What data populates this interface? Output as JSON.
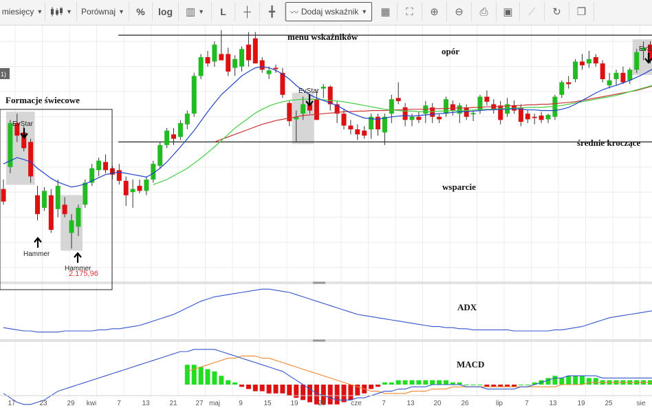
{
  "toolbar": {
    "period": "miesięcy",
    "compare": "Porównaj",
    "percent": "%",
    "log": "log",
    "line": "L",
    "add_indicator": "Dodaj wskaźnik",
    "icons": [
      "candles-icon",
      "bars-icon",
      "crosshair-icon",
      "crosshair2-icon",
      "grid-icon",
      "fullscreen-icon",
      "zoom-in-icon",
      "zoom-out-icon",
      "print-icon",
      "image-icon",
      "chart-icon",
      "refresh-icon",
      "window-icon"
    ]
  },
  "annotations": {
    "menu": "menu wskaźników",
    "resistance": "opór",
    "support": "wsparcie",
    "moving_averages": "średnie kroczące",
    "candle_patterns": "Formacje świecowe",
    "adx": "ADX",
    "macd": "MACD",
    "evstar": "EvStar",
    "hammer": "Hammer",
    "evs_cut": "EvS",
    "price_label": "2.175,96",
    "legend_cut": "1)"
  },
  "colors": {
    "up": "#22bb22",
    "down": "#dd1111",
    "sma_short": "#2244cc",
    "sma_mid": "#44cc44",
    "sma_long": "#cc3333",
    "adx": "#3355cc",
    "macd": "#3355cc",
    "signal": "#ee8833"
  },
  "chart_data": {
    "type": "candlestick",
    "x_ticks": [
      "17",
      "23",
      "29",
      "kwi",
      "7",
      "13",
      "21",
      "27",
      "maj",
      "9",
      "15",
      "19",
      "25",
      "cze",
      "7",
      "13",
      "20",
      "26",
      "lip",
      "7",
      "13",
      "19",
      "25",
      "sie"
    ],
    "price_lines": {
      "resistance": 2470,
      "support": 2300
    },
    "y_range": [
      2080,
      2480
    ],
    "candles": [
      {
        "o": 2225,
        "h": 2240,
        "l": 2200,
        "c": 2205
      },
      {
        "o": 2260,
        "h": 2335,
        "l": 2250,
        "c": 2330
      },
      {
        "o": 2330,
        "h": 2345,
        "l": 2300,
        "c": 2310
      },
      {
        "o": 2315,
        "h": 2325,
        "l": 2285,
        "c": 2290
      },
      {
        "o": 2300,
        "h": 2305,
        "l": 2235,
        "c": 2245
      },
      {
        "o": 2215,
        "h": 2230,
        "l": 2175,
        "c": 2185
      },
      {
        "o": 2195,
        "h": 2228,
        "l": 2190,
        "c": 2222
      },
      {
        "o": 2215,
        "h": 2225,
        "l": 2155,
        "c": 2160
      },
      {
        "o": 2193,
        "h": 2240,
        "l": 2180,
        "c": 2230
      },
      {
        "o": 2200,
        "h": 2212,
        "l": 2180,
        "c": 2185
      },
      {
        "o": 2155,
        "h": 2185,
        "l": 2130,
        "c": 2175
      },
      {
        "o": 2165,
        "h": 2200,
        "l": 2150,
        "c": 2195
      },
      {
        "o": 2200,
        "h": 2240,
        "l": 2195,
        "c": 2235
      },
      {
        "o": 2235,
        "h": 2265,
        "l": 2230,
        "c": 2258
      },
      {
        "o": 2255,
        "h": 2275,
        "l": 2245,
        "c": 2270
      },
      {
        "o": 2268,
        "h": 2280,
        "l": 2250,
        "c": 2255
      },
      {
        "o": 2258,
        "h": 2262,
        "l": 2240,
        "c": 2248
      },
      {
        "o": 2255,
        "h": 2265,
        "l": 2232,
        "c": 2238
      },
      {
        "o": 2238,
        "h": 2245,
        "l": 2198,
        "c": 2215
      },
      {
        "o": 2220,
        "h": 2240,
        "l": 2195,
        "c": 2225
      },
      {
        "o": 2230,
        "h": 2240,
        "l": 2218,
        "c": 2222
      },
      {
        "o": 2222,
        "h": 2245,
        "l": 2215,
        "c": 2240
      },
      {
        "o": 2240,
        "h": 2270,
        "l": 2235,
        "c": 2265
      },
      {
        "o": 2262,
        "h": 2300,
        "l": 2258,
        "c": 2295
      },
      {
        "o": 2295,
        "h": 2322,
        "l": 2290,
        "c": 2318
      },
      {
        "o": 2312,
        "h": 2322,
        "l": 2295,
        "c": 2305
      },
      {
        "o": 2308,
        "h": 2335,
        "l": 2303,
        "c": 2330
      },
      {
        "o": 2328,
        "h": 2350,
        "l": 2320,
        "c": 2345
      },
      {
        "o": 2345,
        "h": 2410,
        "l": 2340,
        "c": 2405
      },
      {
        "o": 2405,
        "h": 2440,
        "l": 2400,
        "c": 2435
      },
      {
        "o": 2435,
        "h": 2445,
        "l": 2420,
        "c": 2425
      },
      {
        "o": 2428,
        "h": 2460,
        "l": 2420,
        "c": 2455
      },
      {
        "o": 2440,
        "h": 2478,
        "l": 2430,
        "c": 2430
      },
      {
        "o": 2440,
        "h": 2450,
        "l": 2405,
        "c": 2412
      },
      {
        "o": 2418,
        "h": 2438,
        "l": 2405,
        "c": 2432
      },
      {
        "o": 2420,
        "h": 2452,
        "l": 2412,
        "c": 2448
      },
      {
        "o": 2455,
        "h": 2475,
        "l": 2420,
        "c": 2430
      },
      {
        "o": 2465,
        "h": 2475,
        "l": 2425,
        "c": 2425
      },
      {
        "o": 2430,
        "h": 2435,
        "l": 2410,
        "c": 2415
      },
      {
        "o": 2408,
        "h": 2420,
        "l": 2400,
        "c": 2414
      },
      {
        "o": 2418,
        "h": 2423,
        "l": 2410,
        "c": 2416
      },
      {
        "o": 2410,
        "h": 2418,
        "l": 2370,
        "c": 2375
      },
      {
        "o": 2362,
        "h": 2365,
        "l": 2325,
        "c": 2333
      },
      {
        "o": 2336,
        "h": 2350,
        "l": 2300,
        "c": 2340
      },
      {
        "o": 2345,
        "h": 2372,
        "l": 2335,
        "c": 2360
      },
      {
        "o": 2360,
        "h": 2375,
        "l": 2345,
        "c": 2350
      },
      {
        "o": 2368,
        "h": 2380,
        "l": 2340,
        "c": 2335
      },
      {
        "o": 2385,
        "h": 2392,
        "l": 2370,
        "c": 2388
      },
      {
        "o": 2388,
        "h": 2390,
        "l": 2350,
        "c": 2360
      },
      {
        "o": 2360,
        "h": 2365,
        "l": 2330,
        "c": 2345
      },
      {
        "o": 2345,
        "h": 2352,
        "l": 2320,
        "c": 2326
      },
      {
        "o": 2326,
        "h": 2335,
        "l": 2312,
        "c": 2320
      },
      {
        "o": 2320,
        "h": 2328,
        "l": 2303,
        "c": 2312
      },
      {
        "o": 2318,
        "h": 2325,
        "l": 2305,
        "c": 2310
      },
      {
        "o": 2320,
        "h": 2345,
        "l": 2305,
        "c": 2340
      },
      {
        "o": 2340,
        "h": 2345,
        "l": 2310,
        "c": 2320
      },
      {
        "o": 2315,
        "h": 2345,
        "l": 2295,
        "c": 2340
      },
      {
        "o": 2345,
        "h": 2375,
        "l": 2330,
        "c": 2368
      },
      {
        "o": 2370,
        "h": 2395,
        "l": 2360,
        "c": 2365
      },
      {
        "o": 2355,
        "h": 2362,
        "l": 2325,
        "c": 2335
      },
      {
        "o": 2335,
        "h": 2345,
        "l": 2325,
        "c": 2340
      },
      {
        "o": 2340,
        "h": 2348,
        "l": 2330,
        "c": 2335
      },
      {
        "o": 2345,
        "h": 2365,
        "l": 2330,
        "c": 2358
      },
      {
        "o": 2355,
        "h": 2362,
        "l": 2330,
        "c": 2340
      },
      {
        "o": 2340,
        "h": 2345,
        "l": 2330,
        "c": 2336
      },
      {
        "o": 2345,
        "h": 2372,
        "l": 2340,
        "c": 2368
      },
      {
        "o": 2360,
        "h": 2366,
        "l": 2342,
        "c": 2350
      },
      {
        "o": 2345,
        "h": 2362,
        "l": 2330,
        "c": 2358
      },
      {
        "o": 2355,
        "h": 2360,
        "l": 2335,
        "c": 2340
      },
      {
        "o": 2344,
        "h": 2350,
        "l": 2333,
        "c": 2346
      },
      {
        "o": 2350,
        "h": 2375,
        "l": 2345,
        "c": 2372
      },
      {
        "o": 2372,
        "h": 2382,
        "l": 2358,
        "c": 2364
      },
      {
        "o": 2360,
        "h": 2368,
        "l": 2345,
        "c": 2352
      },
      {
        "o": 2358,
        "h": 2365,
        "l": 2328,
        "c": 2335
      },
      {
        "o": 2345,
        "h": 2370,
        "l": 2340,
        "c": 2360
      },
      {
        "o": 2358,
        "h": 2366,
        "l": 2345,
        "c": 2350
      },
      {
        "o": 2355,
        "h": 2360,
        "l": 2325,
        "c": 2332
      },
      {
        "o": 2345,
        "h": 2350,
        "l": 2330,
        "c": 2336
      },
      {
        "o": 2340,
        "h": 2345,
        "l": 2328,
        "c": 2338
      },
      {
        "o": 2342,
        "h": 2348,
        "l": 2330,
        "c": 2335
      },
      {
        "o": 2336,
        "h": 2345,
        "l": 2330,
        "c": 2343
      },
      {
        "o": 2340,
        "h": 2375,
        "l": 2335,
        "c": 2372
      },
      {
        "o": 2375,
        "h": 2398,
        "l": 2370,
        "c": 2395
      },
      {
        "o": 2395,
        "h": 2405,
        "l": 2385,
        "c": 2392
      },
      {
        "o": 2400,
        "h": 2432,
        "l": 2395,
        "c": 2428
      },
      {
        "o": 2428,
        "h": 2440,
        "l": 2415,
        "c": 2422
      },
      {
        "o": 2425,
        "h": 2445,
        "l": 2418,
        "c": 2432
      },
      {
        "o": 2435,
        "h": 2440,
        "l": 2420,
        "c": 2425
      },
      {
        "o": 2425,
        "h": 2430,
        "l": 2395,
        "c": 2400
      },
      {
        "o": 2390,
        "h": 2410,
        "l": 2385,
        "c": 2398
      },
      {
        "o": 2400,
        "h": 2415,
        "l": 2390,
        "c": 2410
      },
      {
        "o": 2410,
        "h": 2420,
        "l": 2392,
        "c": 2395
      },
      {
        "o": 2398,
        "h": 2418,
        "l": 2392,
        "c": 2415
      },
      {
        "o": 2415,
        "h": 2448,
        "l": 2410,
        "c": 2443
      },
      {
        "o": 2445,
        "h": 2460,
        "l": 2430,
        "c": 2450
      },
      {
        "o": 2455,
        "h": 2460,
        "l": 2425,
        "c": 2430
      }
    ],
    "sma_short": [
      2265,
      2270,
      2275,
      2272,
      2268,
      2258,
      2250,
      2242,
      2236,
      2232,
      2228,
      2230,
      2233,
      2238,
      2243,
      2248,
      2250,
      2252,
      2250,
      2248,
      2246,
      2244,
      2250,
      2258,
      2268,
      2280,
      2292,
      2305,
      2318,
      2333,
      2348,
      2362,
      2375,
      2385,
      2395,
      2405,
      2412,
      2418,
      2420,
      2418,
      2414,
      2408,
      2400,
      2390,
      2382,
      2375,
      2370,
      2366,
      2362,
      2358,
      2352,
      2346,
      2342,
      2338,
      2337,
      2336,
      2338,
      2340,
      2341,
      2342,
      2341,
      2342,
      2343,
      2344,
      2345,
      2346,
      2347,
      2348,
      2348,
      2349,
      2350,
      2351,
      2351,
      2352,
      2352,
      2353,
      2352,
      2351,
      2351,
      2350,
      2350,
      2350,
      2352,
      2355,
      2360,
      2366,
      2372,
      2378,
      2383,
      2387,
      2390,
      2394,
      2398,
      2403,
      2408,
      2414,
      2420
    ],
    "sma_mid": [
      null,
      null,
      null,
      null,
      null,
      null,
      null,
      null,
      null,
      null,
      null,
      null,
      null,
      null,
      null,
      null,
      null,
      null,
      null,
      null,
      null,
      null,
      2232,
      2236,
      2240,
      2246,
      2252,
      2258,
      2266,
      2274,
      2283,
      2292,
      2302,
      2312,
      2322,
      2330,
      2338,
      2346,
      2352,
      2357,
      2361,
      2364,
      2366,
      2367,
      2368,
      2368,
      2368,
      2367,
      2366,
      2365,
      2364,
      2362,
      2360,
      2358,
      2356,
      2354,
      2352,
      2351,
      2350,
      2349,
      2349,
      2348,
      2348,
      2348,
      2349,
      2349,
      2350,
      2350,
      2350,
      2351,
      2351,
      2352,
      2352,
      2353,
      2353,
      2354,
      2354,
      2355,
      2355,
      2355,
      2356,
      2357,
      2358,
      2360,
      2362,
      2364,
      2366,
      2368,
      2370,
      2372,
      2374,
      2377,
      2380,
      2383,
      2386,
      2389,
      2392
    ],
    "sma_long": [
      null,
      null,
      null,
      null,
      null,
      null,
      null,
      null,
      null,
      null,
      null,
      null,
      null,
      null,
      null,
      null,
      null,
      null,
      null,
      null,
      null,
      null,
      null,
      null,
      null,
      null,
      null,
      null,
      null,
      null,
      null,
      2300,
      2304,
      2308,
      2312,
      2316,
      2320,
      2324,
      2328,
      2331,
      2334,
      2336,
      2338,
      2340,
      2342,
      2343,
      2344,
      2345,
      2346,
      2347,
      2348,
      2348,
      2349,
      2349,
      2350,
      2350,
      2350,
      2351,
      2351,
      2351,
      2352,
      2352,
      2352,
      2353,
      2353,
      2353,
      2354,
      2354,
      2354,
      2355,
      2355,
      2356,
      2356,
      2357,
      2357,
      2358,
      2358,
      2359,
      2359,
      2360,
      2360,
      2361,
      2362,
      2363,
      2364,
      2366,
      2368,
      2370,
      2372,
      2374,
      2376,
      2378,
      2380,
      2382,
      2385,
      2388,
      2391
    ],
    "adx": [
      18,
      17,
      16,
      15,
      15,
      14,
      14,
      14,
      14,
      15,
      15,
      15,
      15,
      15,
      16,
      16,
      17,
      17,
      18,
      19,
      20,
      22,
      24,
      26,
      28,
      30,
      33,
      36,
      39,
      42,
      44,
      46,
      47,
      48,
      49,
      50,
      51,
      52,
      53,
      53,
      52,
      51,
      50,
      48,
      46,
      44,
      42,
      40,
      38,
      36,
      34,
      32,
      30,
      29,
      28,
      27,
      26,
      25,
      24,
      23,
      22,
      21,
      20,
      19,
      19,
      18,
      18,
      17,
      17,
      16,
      16,
      16,
      16,
      16,
      16,
      15,
      15,
      15,
      15,
      15,
      15,
      16,
      16,
      17,
      18,
      19,
      21,
      23,
      25,
      27,
      28,
      29,
      30,
      31,
      32,
      33,
      34
    ],
    "macd": [
      -4,
      -6,
      -8,
      -9,
      -9,
      -8,
      -7,
      -5,
      -3,
      -2,
      -1,
      0,
      1,
      2,
      3,
      4,
      5,
      6,
      7,
      8,
      9,
      10,
      11,
      12,
      13,
      14,
      15,
      15,
      16,
      16,
      16,
      16,
      15,
      14,
      13,
      12,
      11,
      10,
      9,
      8,
      7,
      6,
      4,
      2,
      0,
      -2,
      -4,
      -5,
      -6,
      -7,
      -7,
      -7,
      -6,
      -6,
      -5,
      -4,
      -3,
      -3,
      -2,
      -2,
      -1,
      -1,
      -1,
      0,
      0,
      0,
      0,
      0,
      -1,
      -1,
      -1,
      -2,
      -2,
      -2,
      -2,
      -2,
      -1,
      -1,
      0,
      1,
      2,
      3,
      3,
      4,
      4,
      4,
      4,
      4,
      3,
      3,
      3,
      3,
      3,
      3,
      3,
      3,
      3
    ],
    "signal": [
      null,
      null,
      null,
      null,
      null,
      null,
      null,
      null,
      null,
      null,
      null,
      null,
      null,
      null,
      null,
      null,
      null,
      null,
      null,
      null,
      null,
      null,
      null,
      null,
      null,
      null,
      null,
      6,
      7,
      8,
      9,
      10,
      11,
      12,
      12,
      13,
      13,
      13,
      12,
      12,
      11,
      10,
      9,
      8,
      7,
      6,
      5,
      4,
      3,
      2,
      1,
      0,
      -1,
      -2,
      -3,
      -3,
      -4,
      -4,
      -4,
      -4,
      -3,
      -3,
      -3,
      -2,
      -2,
      -2,
      -1,
      -1,
      -1,
      -1,
      -1,
      -1,
      -1,
      -1,
      -1,
      -1,
      -1,
      -1,
      -1,
      -1,
      -1,
      -1,
      0,
      0,
      0,
      0,
      1,
      1,
      1,
      1,
      1,
      1,
      1,
      1,
      1,
      1,
      1
    ]
  }
}
